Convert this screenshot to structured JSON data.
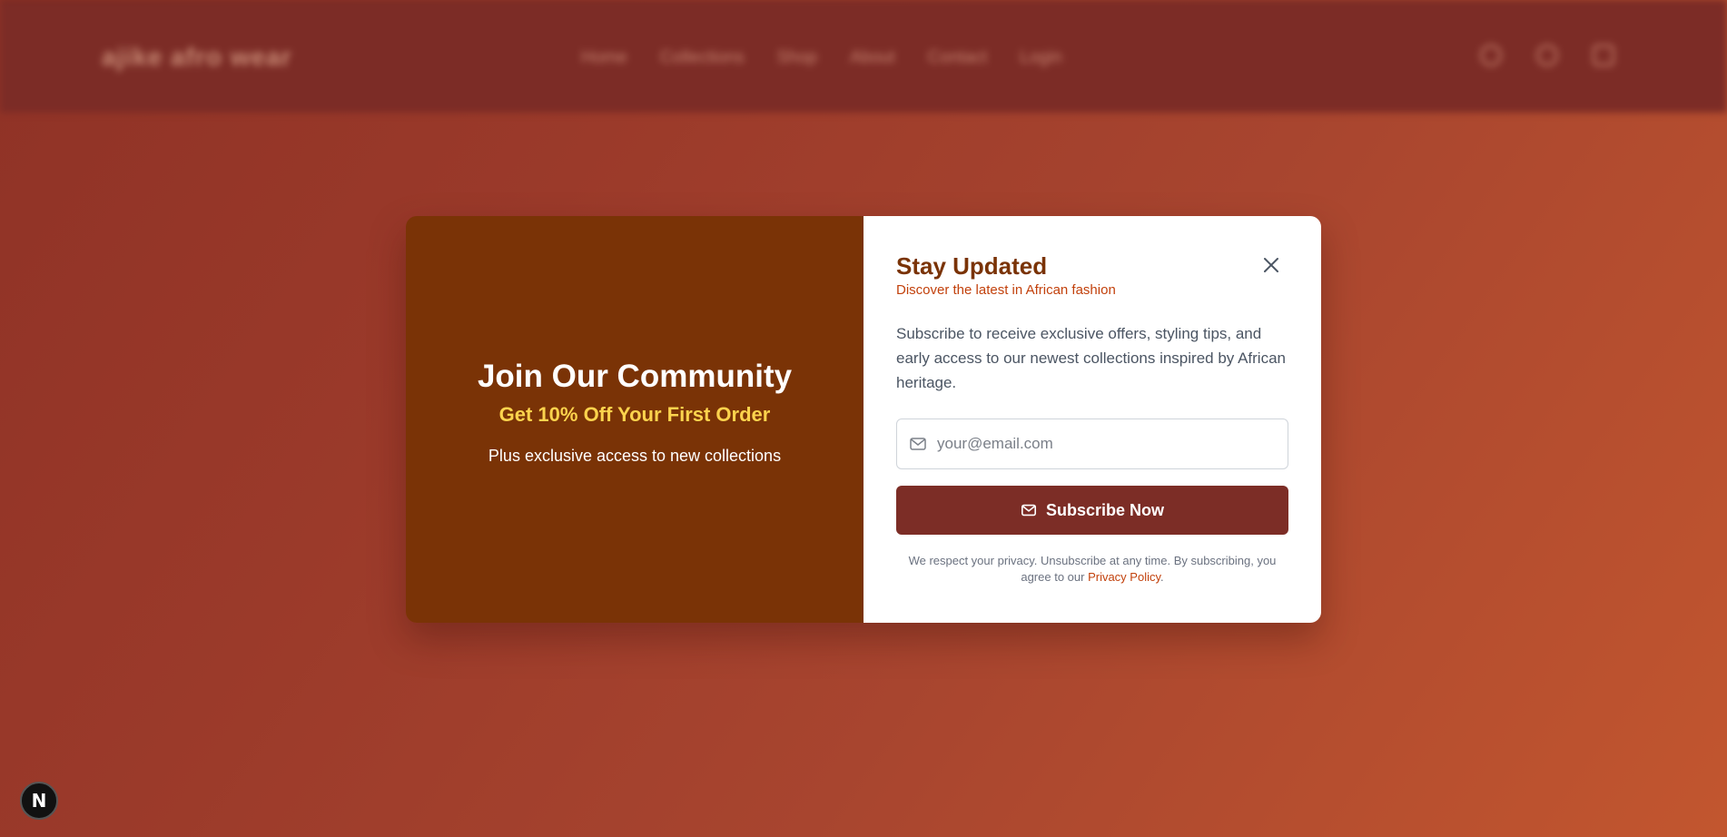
{
  "background": {
    "logo": "ajike afro wear",
    "nav": [
      "Home",
      "Collections",
      "Shop",
      "About",
      "Contact",
      "Login"
    ],
    "icons": [
      "search-icon",
      "user-icon",
      "bag-icon"
    ]
  },
  "modal": {
    "left": {
      "title": "Join Our Community",
      "offer": "Get 10% Off Your First Order",
      "subtitle": "Plus exclusive access to new collections"
    },
    "right": {
      "title": "Stay Updated",
      "subtitle": "Discover the latest in African fashion",
      "description": "Subscribe to receive exclusive offers, styling tips, and early access to our newest collections inspired by African heritage.",
      "email_placeholder": "your@email.com",
      "subscribe_label": "Subscribe Now",
      "privacy_text": "We respect your privacy. Unsubscribe at any time. By subscribing, you agree to our ",
      "privacy_link": "Privacy Policy",
      "privacy_end": "."
    }
  },
  "badge": {
    "label": "N"
  },
  "colors": {
    "left_panel": "#7a3306",
    "offer": "#fcd34d",
    "title": "#7a3306",
    "accent": "#c2410c",
    "button": "#7c2d26"
  }
}
